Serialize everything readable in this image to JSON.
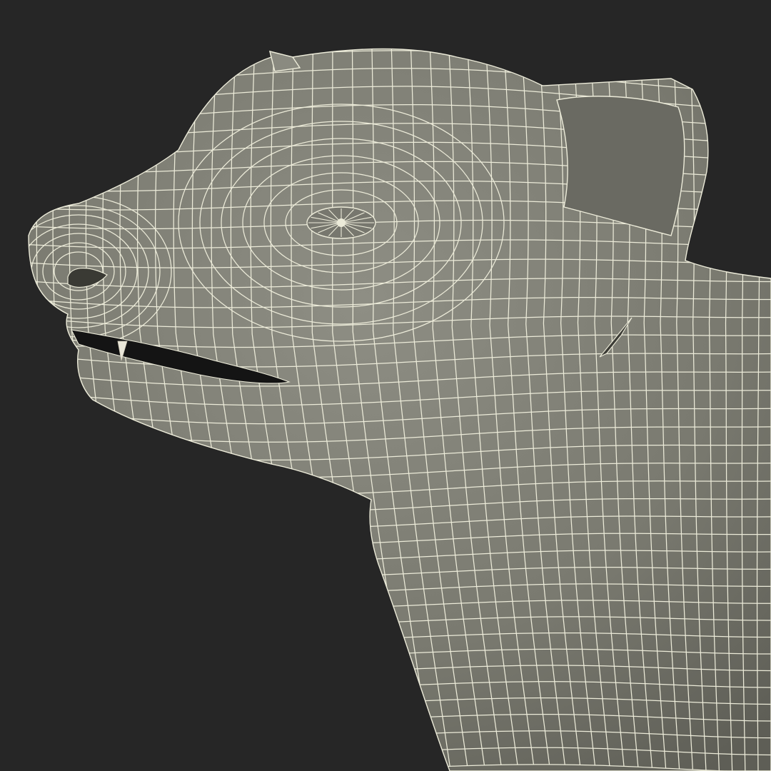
{
  "scene": {
    "subject": "wireframe-animal-head",
    "colors": {
      "background": "#262626",
      "surface": "#7c7c72",
      "surface_light": "#9a9a90",
      "surface_dark": "#55554d",
      "wire": "#ecebd9",
      "mouth": "#141414"
    }
  }
}
